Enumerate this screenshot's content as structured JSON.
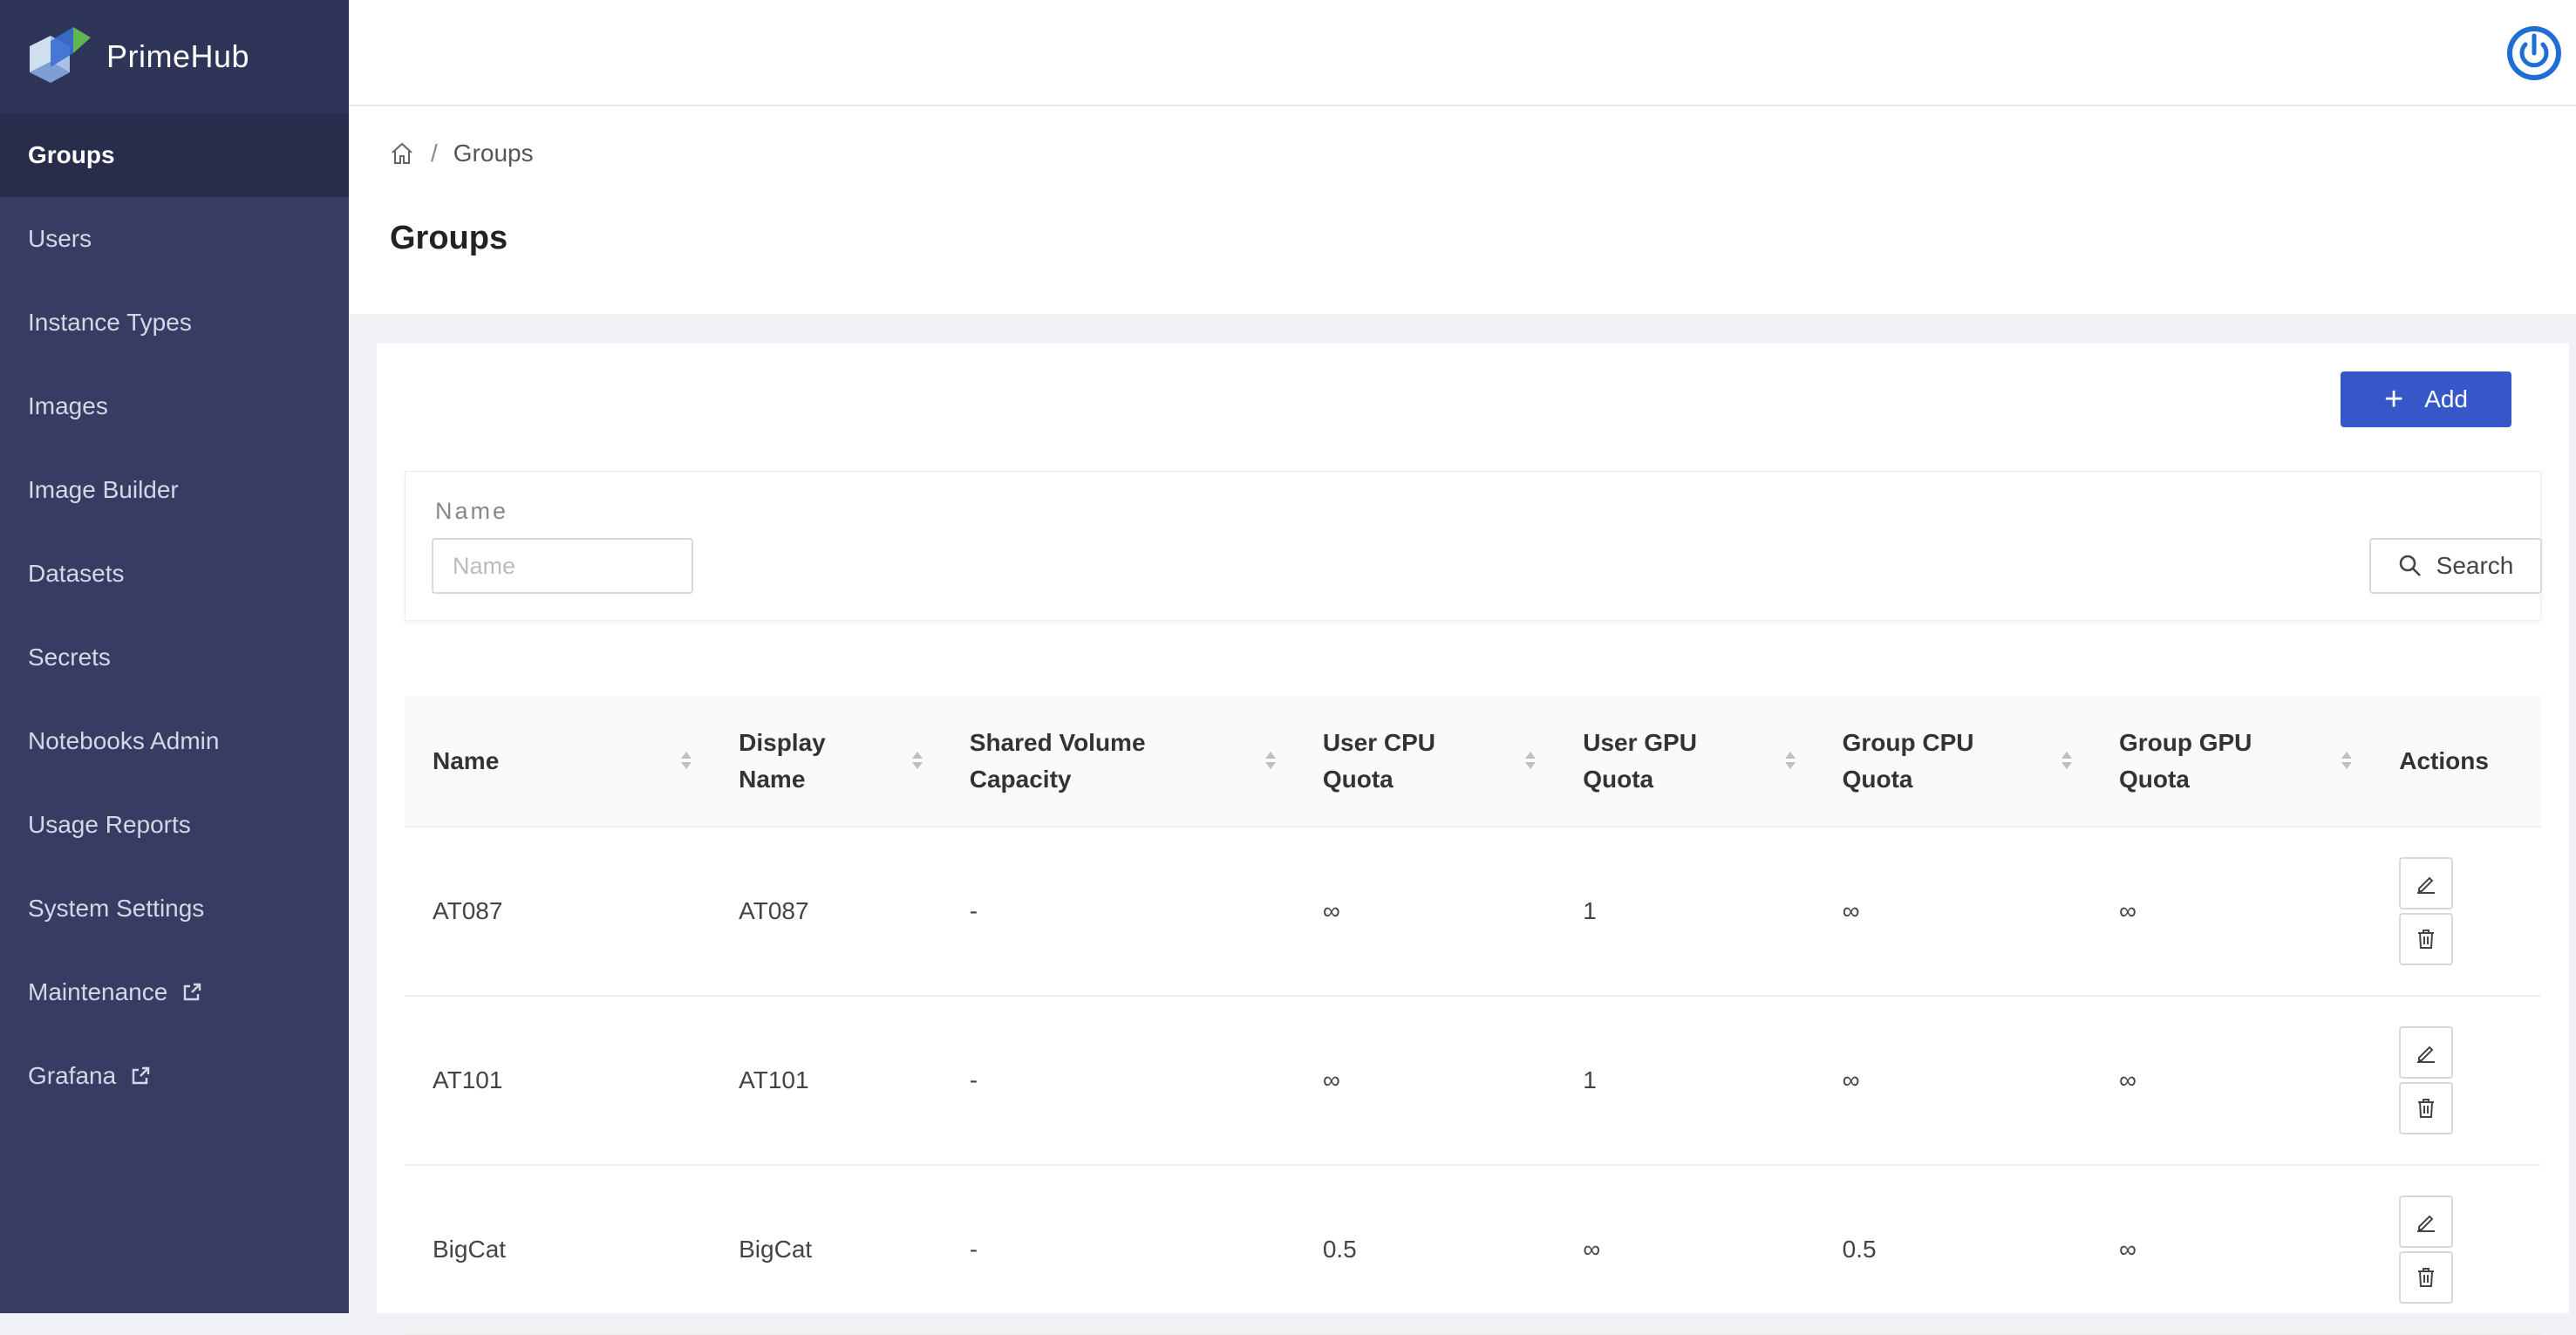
{
  "app": {
    "name": "PrimeHub"
  },
  "sidebar": {
    "items": [
      {
        "label": "Groups",
        "active": true
      },
      {
        "label": "Users"
      },
      {
        "label": "Instance Types"
      },
      {
        "label": "Images"
      },
      {
        "label": "Image Builder"
      },
      {
        "label": "Datasets"
      },
      {
        "label": "Secrets"
      },
      {
        "label": "Notebooks Admin"
      },
      {
        "label": "Usage Reports"
      },
      {
        "label": "System Settings"
      },
      {
        "label": "Maintenance",
        "external": true
      },
      {
        "label": "Grafana",
        "external": true
      }
    ]
  },
  "breadcrumb": {
    "current": "Groups"
  },
  "page": {
    "title": "Groups"
  },
  "toolbar": {
    "add_label": "Add"
  },
  "filter": {
    "label": "Name",
    "placeholder": "Name",
    "value": "",
    "search_label": "Search"
  },
  "table": {
    "columns": [
      "Name",
      "Display Name",
      "Shared Volume Capacity",
      "User CPU Quota",
      "User GPU Quota",
      "Group CPU Quota",
      "Group GPU Quota",
      "Actions"
    ],
    "rows": [
      {
        "name": "AT087",
        "display_name": "AT087",
        "shared_volume": "-",
        "user_cpu": "∞",
        "user_gpu": "1",
        "group_cpu": "∞",
        "group_gpu": "∞"
      },
      {
        "name": "AT101",
        "display_name": "AT101",
        "shared_volume": "-",
        "user_cpu": "∞",
        "user_gpu": "1",
        "group_cpu": "∞",
        "group_gpu": "∞"
      },
      {
        "name": "BigCat",
        "display_name": "BigCat",
        "shared_volume": "-",
        "user_cpu": "0.5",
        "user_gpu": "∞",
        "group_cpu": "0.5",
        "group_gpu": "∞"
      }
    ]
  },
  "colors": {
    "sidebar": "#373d62",
    "sidebar_active": "#282d4b",
    "accent": "#3657c8"
  }
}
